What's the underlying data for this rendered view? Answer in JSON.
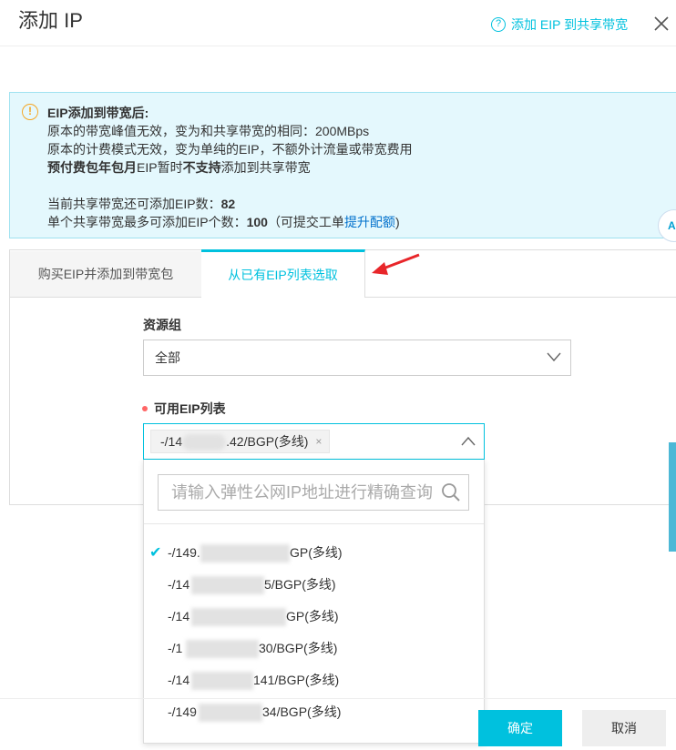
{
  "dialog": {
    "title": "添加 IP",
    "help_link": "添加 EIP 到共享带宽",
    "help_icon": "?"
  },
  "notice": {
    "icon": "!",
    "heading": "EIP添加到带宽后:",
    "line1": "原本的带宽峰值无效，变为和共享带宽的相同：200MBps",
    "line2": "原本的计费模式无效，变为单纯的EIP，不额外计流量或带宽费用",
    "line3_bold1": "预付费包年包月",
    "line3_mid": "EIP暂时",
    "line3_bold2": "不支持",
    "line3_end": "添加到共享带宽",
    "remaining_label": "当前共享带宽还可添加EIP数：",
    "remaining_value": "82",
    "max_label": "单个共享带宽最多可添加EIP个数：",
    "max_value": "100",
    "max_suffix_pre": "（可提交工单",
    "max_link": "提升配额",
    "max_suffix_post": ")",
    "side_bubble": "A"
  },
  "tabs": [
    {
      "label": "购买EIP并添加到带宽包",
      "active": false
    },
    {
      "label": "从已有EIP列表选取",
      "active": true
    }
  ],
  "form": {
    "resource_group_label": "资源组",
    "resource_group_value": "全部",
    "eip_list_label": "可用EIP列表",
    "selected_chip_prefix": "-/14",
    "selected_chip_suffix": ".42/BGP(多线)",
    "chip_remove": "×",
    "search_placeholder": "请输入弹性公网IP地址进行精确查询"
  },
  "options": [
    {
      "prefix": "-/149.",
      "suffix": "GP(多线)",
      "checked": true
    },
    {
      "prefix": "-/14",
      "suffix": "5/BGP(多线)",
      "checked": false
    },
    {
      "prefix": "-/14",
      "suffix": "GP(多线)",
      "checked": false
    },
    {
      "prefix": "-/1",
      "suffix": "30/BGP(多线)",
      "checked": false
    },
    {
      "prefix": "-/14",
      "suffix": "141/BGP(多线)",
      "checked": false
    },
    {
      "prefix": "-/149",
      "suffix": "34/BGP(多线)",
      "checked": false
    }
  ],
  "footer": {
    "ok_label": "确定",
    "cancel_label": "取消"
  },
  "colors": {
    "accent": "#00c1de",
    "notice_bg": "#e4f8fd",
    "annotation_arrow": "#e8262a"
  }
}
